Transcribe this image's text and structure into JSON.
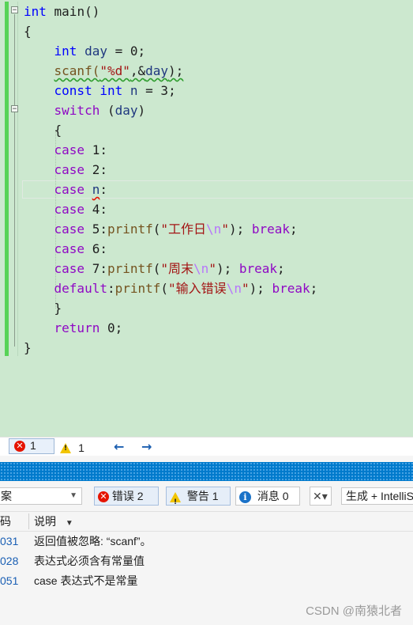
{
  "editor": {
    "code": [
      {
        "segs": [
          {
            "t": "int",
            "c": "kw"
          },
          {
            "t": " main()",
            "c": "plain"
          }
        ]
      },
      {
        "segs": [
          {
            "t": "{",
            "c": "plain"
          }
        ]
      },
      {
        "segs": [
          {
            "t": "    ",
            "c": "plain"
          },
          {
            "t": "int",
            "c": "kw"
          },
          {
            "t": " ",
            "c": "plain"
          },
          {
            "t": "day",
            "c": "var"
          },
          {
            "t": " = 0;",
            "c": "plain"
          }
        ]
      },
      {
        "segs": [
          {
            "t": "    ",
            "c": "plain"
          },
          {
            "t": "scanf(",
            "c": "fn squiggle-green"
          },
          {
            "t": "\"%d\"",
            "c": "str squiggle-green"
          },
          {
            "t": ",&",
            "c": "plain squiggle-green"
          },
          {
            "t": "day",
            "c": "var squiggle-green"
          },
          {
            "t": ");",
            "c": "plain squiggle-green"
          }
        ]
      },
      {
        "segs": [
          {
            "t": "    ",
            "c": "plain"
          },
          {
            "t": "const",
            "c": "kw"
          },
          {
            "t": " ",
            "c": "plain"
          },
          {
            "t": "int",
            "c": "kw"
          },
          {
            "t": " ",
            "c": "plain"
          },
          {
            "t": "n",
            "c": "var"
          },
          {
            "t": " = 3;",
            "c": "plain"
          }
        ]
      },
      {
        "segs": [
          {
            "t": "    ",
            "c": "plain"
          },
          {
            "t": "switch",
            "c": "kw2"
          },
          {
            "t": " (",
            "c": "plain"
          },
          {
            "t": "day",
            "c": "var"
          },
          {
            "t": ")",
            "c": "plain"
          }
        ]
      },
      {
        "segs": [
          {
            "t": "    {",
            "c": "plain"
          }
        ]
      },
      {
        "segs": [
          {
            "t": "    ",
            "c": "plain"
          },
          {
            "t": "case",
            "c": "kw2"
          },
          {
            "t": " 1:",
            "c": "plain"
          }
        ]
      },
      {
        "segs": [
          {
            "t": "    ",
            "c": "plain"
          },
          {
            "t": "case",
            "c": "kw2"
          },
          {
            "t": " 2:",
            "c": "plain"
          }
        ]
      },
      {
        "segs": [
          {
            "t": "    ",
            "c": "plain"
          },
          {
            "t": "case",
            "c": "kw2"
          },
          {
            "t": " ",
            "c": "plain"
          },
          {
            "t": "n",
            "c": "var squiggle-red"
          },
          {
            "t": ":",
            "c": "plain"
          }
        ]
      },
      {
        "segs": [
          {
            "t": "    ",
            "c": "plain"
          },
          {
            "t": "case",
            "c": "kw2"
          },
          {
            "t": " 4:",
            "c": "plain"
          }
        ]
      },
      {
        "segs": [
          {
            "t": "    ",
            "c": "plain"
          },
          {
            "t": "case",
            "c": "kw2"
          },
          {
            "t": " 5:",
            "c": "plain"
          },
          {
            "t": "printf",
            "c": "fn"
          },
          {
            "t": "(",
            "c": "plain"
          },
          {
            "t": "\"工作日",
            "c": "str"
          },
          {
            "t": "\\n",
            "c": "esc"
          },
          {
            "t": "\"",
            "c": "str"
          },
          {
            "t": "); ",
            "c": "plain"
          },
          {
            "t": "break",
            "c": "kw2"
          },
          {
            "t": ";",
            "c": "plain"
          }
        ]
      },
      {
        "segs": [
          {
            "t": "    ",
            "c": "plain"
          },
          {
            "t": "case",
            "c": "kw2"
          },
          {
            "t": " 6:",
            "c": "plain"
          }
        ]
      },
      {
        "segs": [
          {
            "t": "    ",
            "c": "plain"
          },
          {
            "t": "case",
            "c": "kw2"
          },
          {
            "t": " 7:",
            "c": "plain"
          },
          {
            "t": "printf",
            "c": "fn"
          },
          {
            "t": "(",
            "c": "plain"
          },
          {
            "t": "\"周末",
            "c": "str"
          },
          {
            "t": "\\n",
            "c": "esc"
          },
          {
            "t": "\"",
            "c": "str"
          },
          {
            "t": "); ",
            "c": "plain"
          },
          {
            "t": "break",
            "c": "kw2"
          },
          {
            "t": ";",
            "c": "plain"
          }
        ]
      },
      {
        "segs": [
          {
            "t": "    ",
            "c": "plain"
          },
          {
            "t": "default",
            "c": "kw2"
          },
          {
            "t": ":",
            "c": "plain"
          },
          {
            "t": "printf",
            "c": "fn"
          },
          {
            "t": "(",
            "c": "plain"
          },
          {
            "t": "\"输入错误",
            "c": "str"
          },
          {
            "t": "\\n",
            "c": "esc"
          },
          {
            "t": "\"",
            "c": "str"
          },
          {
            "t": "); ",
            "c": "plain"
          },
          {
            "t": "break",
            "c": "kw2"
          },
          {
            "t": ";",
            "c": "plain"
          }
        ]
      },
      {
        "segs": [
          {
            "t": "    }",
            "c": "plain"
          }
        ]
      },
      {
        "segs": [
          {
            "t": "    ",
            "c": "plain"
          },
          {
            "t": "return",
            "c": "kw2"
          },
          {
            "t": " 0;",
            "c": "plain"
          }
        ]
      },
      {
        "segs": [
          {
            "t": "}",
            "c": "plain"
          }
        ]
      }
    ]
  },
  "status": {
    "error_count": "1",
    "warning_count": "1",
    "prev_arrow": "←",
    "next_arrow": "→"
  },
  "error_list": {
    "scope_label": "案",
    "errors_button": "错误 2",
    "warnings_button": "警告 1",
    "messages_button": "消息 0",
    "build_filter": "生成 + IntelliSense",
    "col_code": "码",
    "col_desc": "说明",
    "rows": [
      {
        "code": "031",
        "desc": "返回值被忽略: “scanf”。"
      },
      {
        "code": "028",
        "desc": "表达式必须含有常量值"
      },
      {
        "code": "051",
        "desc": "case 表达式不是常量"
      }
    ]
  },
  "watermark": "CSDN @南猿北者"
}
